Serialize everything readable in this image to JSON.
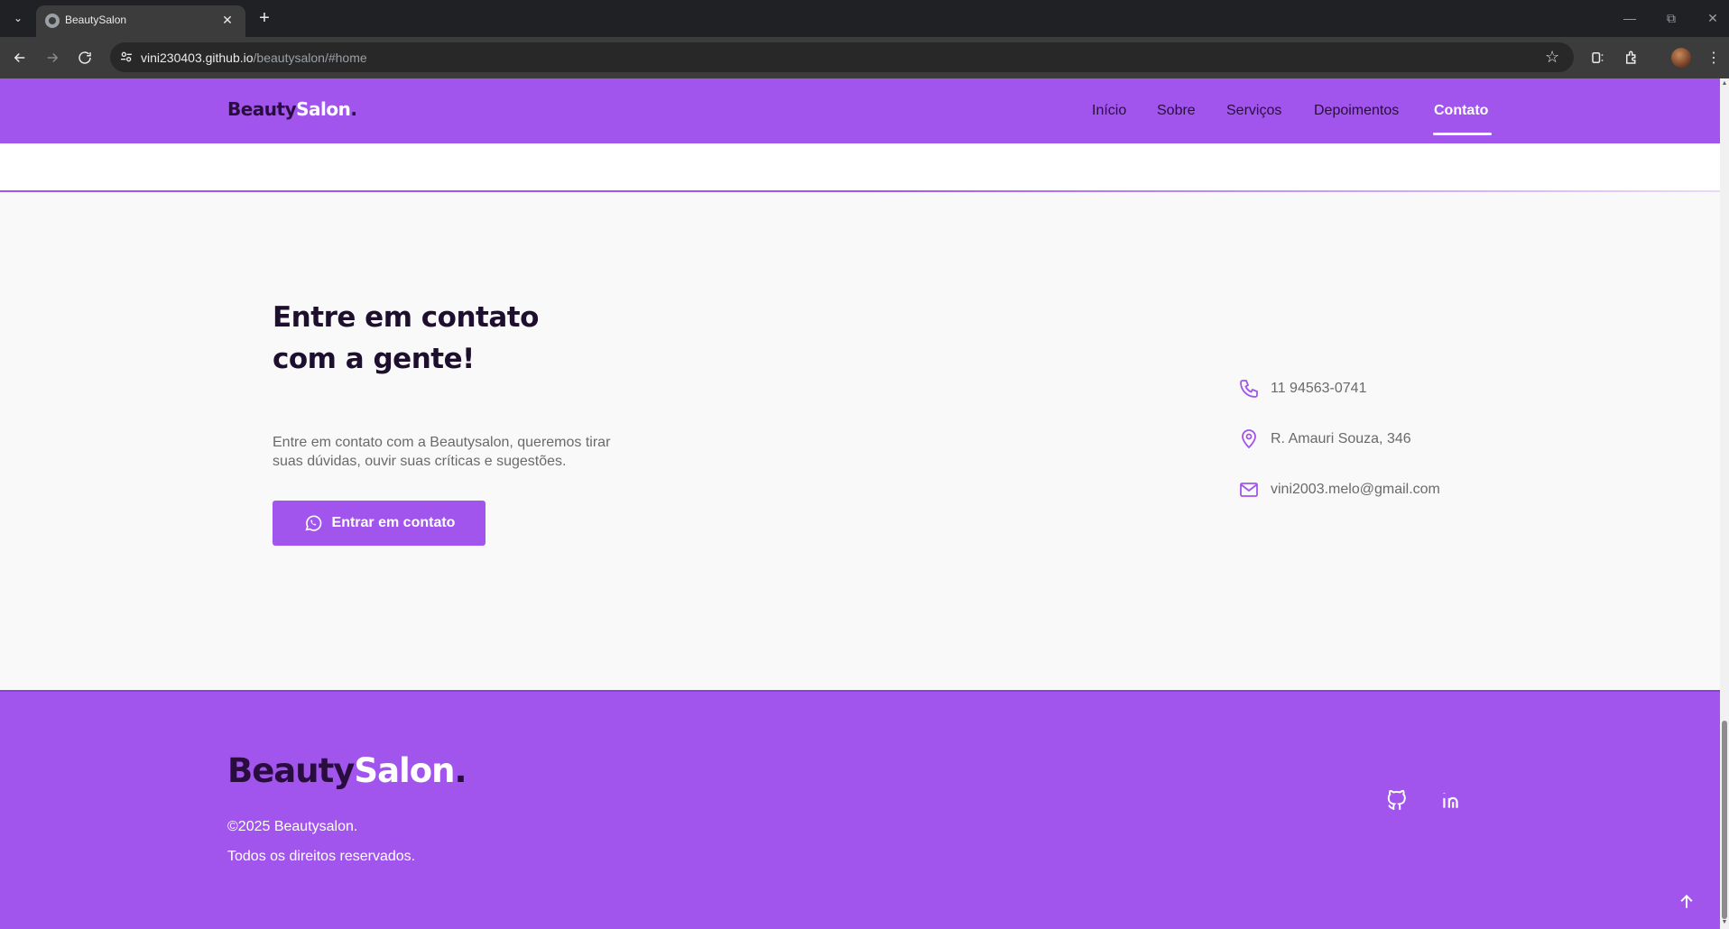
{
  "browser": {
    "tab_title": "BeautySalon",
    "url_host": "vini230403.github.io",
    "url_path": "/beautysalon/#home"
  },
  "header": {
    "logo_part1": "Beauty",
    "logo_part2": "Salon",
    "logo_dot": ".",
    "nav": [
      {
        "label": "Início",
        "active": false
      },
      {
        "label": "Sobre",
        "active": false
      },
      {
        "label": "Serviços",
        "active": false
      },
      {
        "label": "Depoimentos",
        "active": false
      },
      {
        "label": "Contato",
        "active": true
      }
    ]
  },
  "contact": {
    "title_line1": "Entre em contato",
    "title_line2": "com a gente!",
    "text_line1": "Entre em contato com a Beautysalon, queremos tirar",
    "text_line2": "suas dúvidas, ouvir suas críticas e sugestões.",
    "button_label": "Entrar em contato",
    "phone": "11 94563-0741",
    "address": "R. Amauri Souza, 346",
    "email": "vini2003.melo@gmail.com"
  },
  "footer": {
    "logo_part1": "Beauty",
    "logo_part2": "Salon",
    "logo_dot": ".",
    "copyright": "©2025 Beautysalon.",
    "rights": "Todos os direitos reservados.",
    "social": [
      "github-icon",
      "linkedin-icon"
    ]
  },
  "colors": {
    "brand_purple": "#a155ec",
    "dark": "#2a0d3f",
    "section_bg": "#f9f9f9"
  }
}
